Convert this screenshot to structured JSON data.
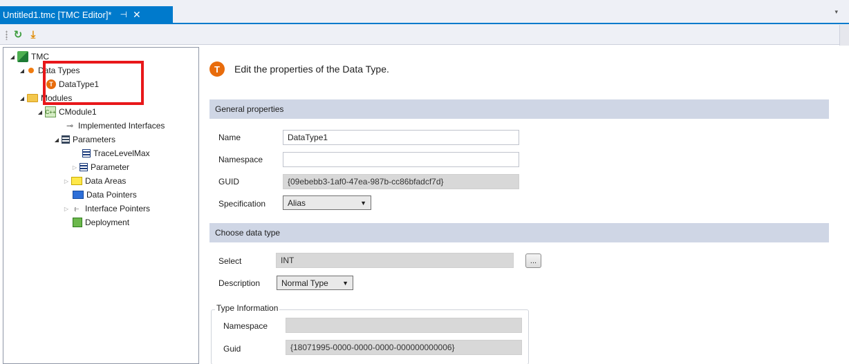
{
  "tab": {
    "title": "Untitled1.tmc [TMC Editor]*",
    "pin_glyph": "⊣",
    "close_glyph": "✕",
    "overflow_glyph": "▾"
  },
  "toolbar": {
    "refresh_icon": "refresh-icon",
    "refresh_glyph": "↻",
    "download_icon": "download-icon",
    "download_glyph": "⤓"
  },
  "tree": {
    "root": "TMC",
    "data_types": "Data Types",
    "datatype1": "DataType1",
    "modules": "Modules",
    "cmodule1": "CModule1",
    "implemented_interfaces": "Implemented Interfaces",
    "parameters": "Parameters",
    "trace_level_max": "TraceLevelMax",
    "parameter": "Parameter",
    "data_areas": "Data Areas",
    "data_pointers": "Data Pointers",
    "interface_pointers": "Interface Pointers",
    "deployment": "Deployment",
    "module_icon_text": "C++",
    "iface_icon_text": "⊸",
    "iptr_icon_text": "⥼"
  },
  "header": {
    "icon_letter": "T",
    "text": "Edit the properties of the Data Type."
  },
  "general": {
    "section_title": "General properties",
    "name_label": "Name",
    "name_value": "DataType1",
    "namespace_label": "Namespace",
    "namespace_value": "",
    "guid_label": "GUID",
    "guid_value": "{09ebebb3-1af0-47ea-987b-cc86bfadcf7d}",
    "spec_label": "Specification",
    "spec_value": "Alias"
  },
  "choose": {
    "section_title": "Choose data type",
    "select_label": "Select",
    "select_value": "INT",
    "browse_label": "...",
    "description_label": "Description",
    "description_value": "Normal Type"
  },
  "type_info": {
    "group_title": "Type Information",
    "namespace_label": "Namespace",
    "namespace_value": "",
    "guid_label": "Guid",
    "guid_value": "{18071995-0000-0000-0000-000000000006}"
  },
  "colors": {
    "accent": "#007acc",
    "highlight_box": "#e8171a",
    "section_bg": "#cfd6e5",
    "type_icon": "#e86c0c"
  }
}
